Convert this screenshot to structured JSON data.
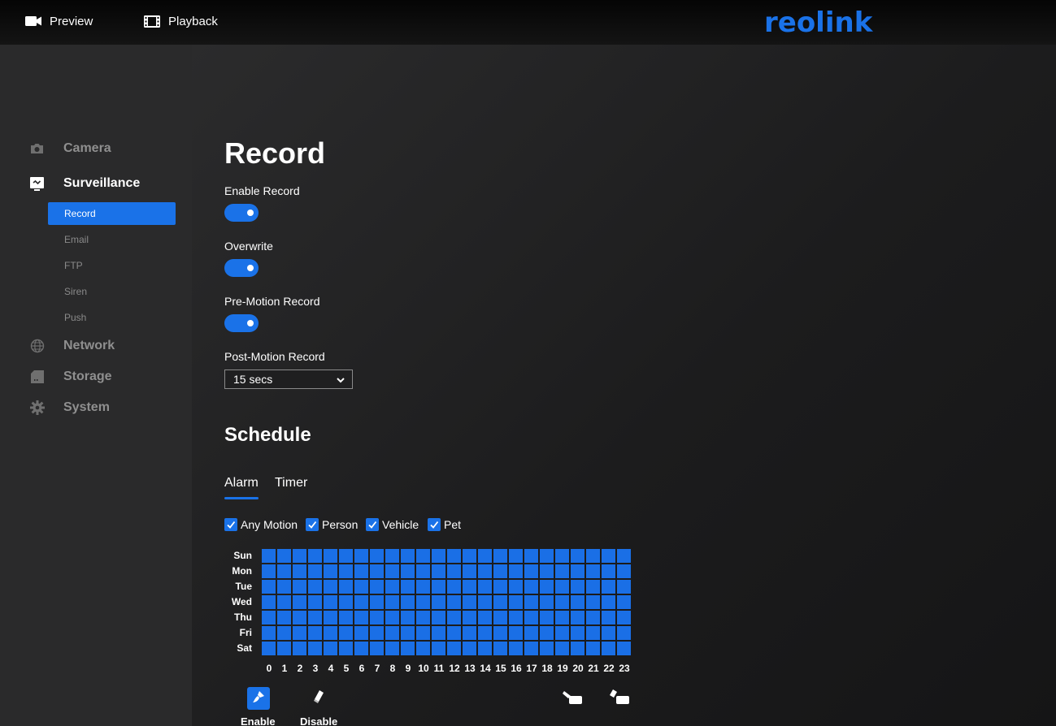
{
  "topbar": {
    "preview_label": "Preview",
    "playback_label": "Playback",
    "logo_text": "reolink",
    "logo_color": "#1a72e8"
  },
  "sidebar": {
    "categories": [
      {
        "label": "Camera",
        "icon": "camera-icon"
      },
      {
        "label": "Surveillance",
        "icon": "surveillance-icon",
        "active": true
      },
      {
        "label": "Network",
        "icon": "globe-icon"
      },
      {
        "label": "Storage",
        "icon": "sd-card-icon"
      },
      {
        "label": "System",
        "icon": "gear-icon"
      }
    ],
    "sub_items": [
      {
        "label": "Record",
        "active": true
      },
      {
        "label": "Email"
      },
      {
        "label": "FTP"
      },
      {
        "label": "Siren"
      },
      {
        "label": "Push"
      }
    ]
  },
  "main": {
    "title": "Record",
    "settings": [
      {
        "label": "Enable Record",
        "enabled": true
      },
      {
        "label": "Overwrite",
        "enabled": true
      },
      {
        "label": "Pre-Motion Record",
        "enabled": true
      }
    ],
    "post_motion": {
      "label": "Post-Motion Record",
      "value": "15 secs"
    },
    "schedule": {
      "title": "Schedule",
      "tabs": [
        {
          "label": "Alarm",
          "active": true
        },
        {
          "label": "Timer"
        }
      ],
      "filters": [
        {
          "label": "Any Motion",
          "checked": true
        },
        {
          "label": "Person",
          "checked": true
        },
        {
          "label": "Vehicle",
          "checked": true
        },
        {
          "label": "Pet",
          "checked": true
        }
      ],
      "days": [
        "Sun",
        "Mon",
        "Tue",
        "Wed",
        "Thu",
        "Fri",
        "Sat"
      ],
      "hours": [
        "0",
        "1",
        "2",
        "3",
        "4",
        "5",
        "6",
        "7",
        "8",
        "9",
        "10",
        "11",
        "12",
        "13",
        "14",
        "15",
        "16",
        "17",
        "18",
        "19",
        "20",
        "21",
        "22",
        "23"
      ],
      "all_cells_selected": true,
      "cell_color": "#1a6fe6",
      "tools": [
        {
          "label": "Enable",
          "icon": "brush-icon",
          "active": true
        },
        {
          "label": "Disable",
          "icon": "eraser-icon"
        },
        {
          "icon": "fill-all-icon"
        },
        {
          "icon": "clear-all-icon"
        }
      ]
    }
  },
  "accent_color": "#1a72e8"
}
